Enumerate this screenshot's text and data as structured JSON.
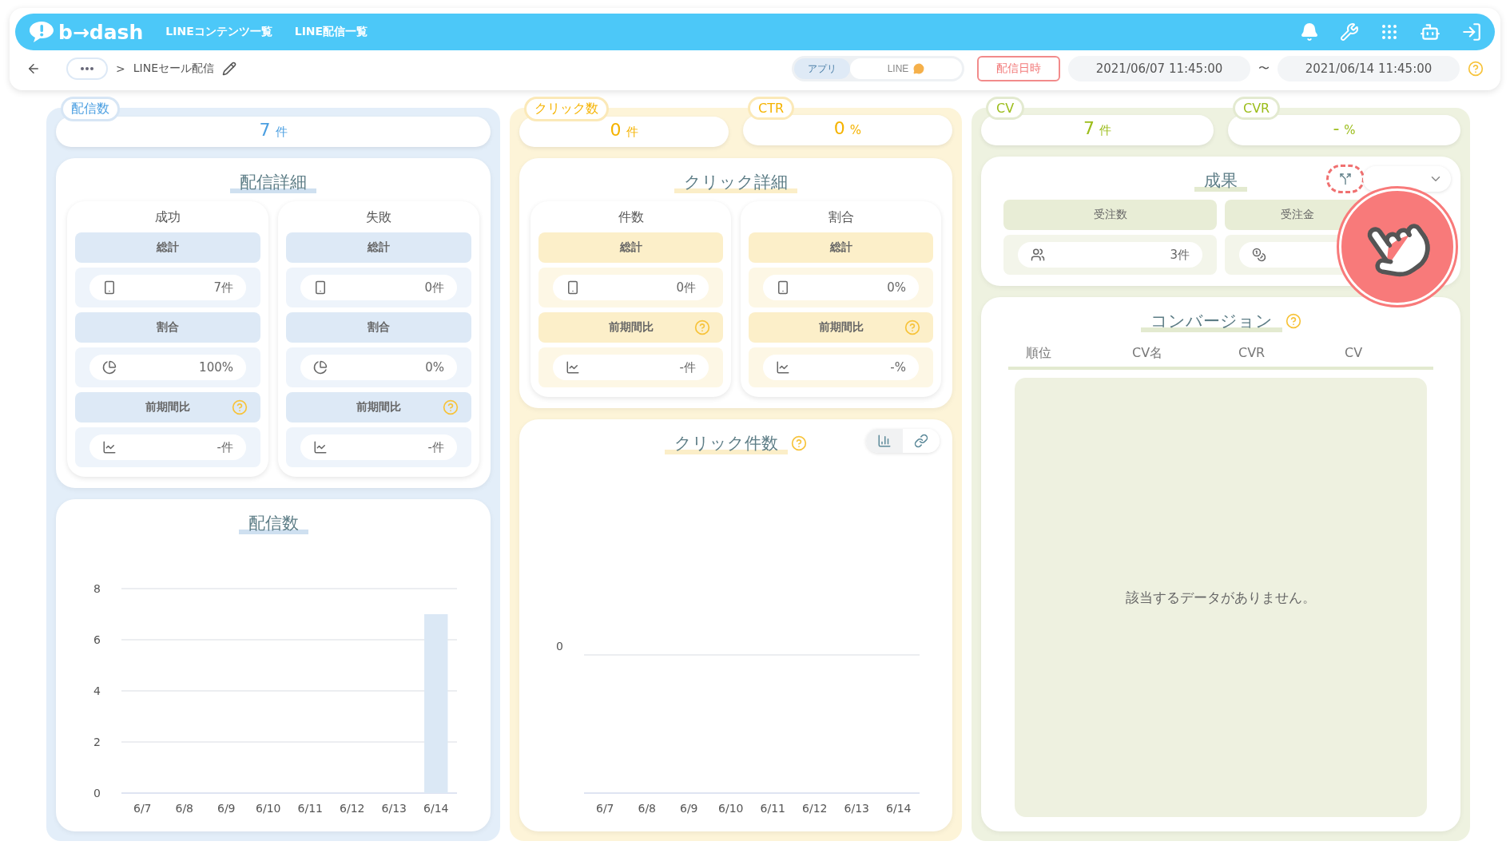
{
  "nav": {
    "logo": "b→dash",
    "links": [
      "LINEコンテンツ一覧",
      "LINE配信一覧"
    ]
  },
  "subbar": {
    "breadcrumb_sep": ">",
    "title": "LINEセール配信",
    "channels": [
      {
        "label": "アプリ",
        "selected": true
      },
      {
        "label": "LINE",
        "selected": false
      }
    ],
    "date_button": "配信日時",
    "start": "2021/06/07 11:45:00",
    "range_sep": "〜",
    "end": "2021/06/14 11:45:00"
  },
  "columns": [
    {
      "metrics": [
        {
          "tag": "配信数",
          "value": "7",
          "unit": "件"
        }
      ],
      "detail": {
        "title": "配信詳細",
        "groups": [
          {
            "title": "成功",
            "sections": [
              {
                "label": "総計",
                "help": false,
                "kind": "total",
                "value": "7件"
              },
              {
                "label": "割合",
                "help": false,
                "kind": "ratio",
                "value": "100%"
              },
              {
                "label": "前期間比",
                "help": true,
                "kind": "change",
                "value": "-件"
              }
            ]
          },
          {
            "title": "失敗",
            "sections": [
              {
                "label": "総計",
                "help": false,
                "kind": "total",
                "value": "0件"
              },
              {
                "label": "割合",
                "help": false,
                "kind": "ratio",
                "value": "0%"
              },
              {
                "label": "前期間比",
                "help": true,
                "kind": "change",
                "value": "-件"
              }
            ]
          }
        ]
      },
      "chart": {
        "title": "配信数",
        "help": false,
        "chart_data": {
          "type": "bar",
          "categories": [
            "6/7",
            "6/8",
            "6/9",
            "6/10",
            "6/11",
            "6/12",
            "6/13",
            "6/14"
          ],
          "values": [
            0,
            0,
            0,
            0,
            0,
            0,
            0,
            7
          ],
          "ylim": [
            0,
            8
          ],
          "yticks": [
            0,
            2,
            4,
            6,
            8
          ],
          "grid": true
        }
      }
    },
    {
      "metrics": [
        {
          "tag": "クリック数",
          "value": "0",
          "unit": "件"
        },
        {
          "tag": "CTR",
          "value": "0",
          "unit": "%"
        }
      ],
      "detail": {
        "title": "クリック詳細",
        "groups": [
          {
            "title": "件数",
            "sections": [
              {
                "label": "総計",
                "help": false,
                "kind": "total",
                "value": "0件"
              },
              {
                "label": "前期間比",
                "help": true,
                "kind": "change",
                "value": "-件"
              }
            ]
          },
          {
            "title": "割合",
            "sections": [
              {
                "label": "総計",
                "help": false,
                "kind": "total",
                "value": "0%"
              },
              {
                "label": "前期間比",
                "help": true,
                "kind": "change",
                "value": "-%"
              }
            ]
          }
        ]
      },
      "chart": {
        "title": "クリック件数",
        "help": true,
        "toggles": [
          {
            "kind": "bar",
            "selected": true
          },
          {
            "kind": "link",
            "selected": false
          }
        ],
        "empty_plot": {
          "categories": [
            "6/7",
            "6/8",
            "6/9",
            "6/10",
            "6/11",
            "6/12",
            "6/13",
            "6/14"
          ],
          "baseline_label": "0"
        }
      }
    },
    {
      "metrics": [
        {
          "tag": "CV",
          "value": "7",
          "unit": "件"
        },
        {
          "tag": "CVR",
          "value": "-",
          "unit": "%"
        }
      ],
      "results": {
        "title": "成果",
        "groups": [
          {
            "label": "受注数",
            "kind": "people",
            "value": "3件"
          },
          {
            "label": "受注金",
            "kind": "coins"
          }
        ]
      },
      "conversion": {
        "title": "コンバージョン",
        "help": true,
        "columns": [
          "順位",
          "CV名",
          "CVR",
          "CV"
        ],
        "empty": "該当するデータがありません。"
      }
    }
  ]
}
